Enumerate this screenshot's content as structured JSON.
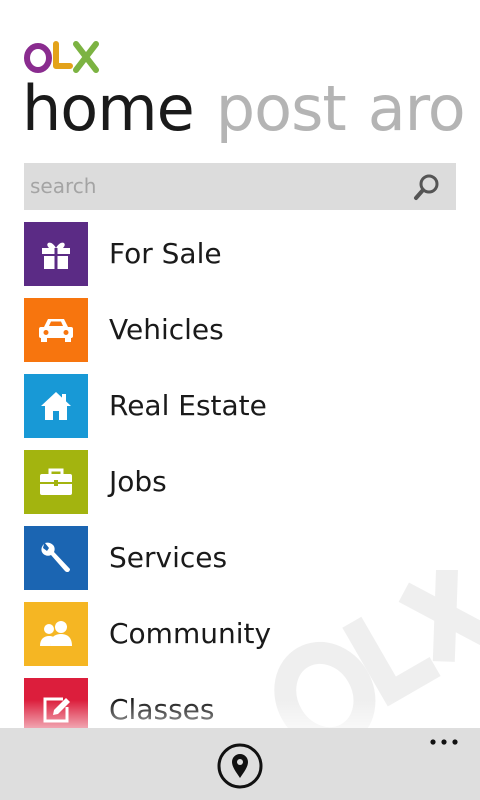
{
  "app": {
    "logo_text": "OLX",
    "logo_colors": [
      "#8a2c8f",
      "#e3a21a",
      "#7cb342"
    ]
  },
  "pivot": {
    "tabs": [
      {
        "label": "home",
        "active": true
      },
      {
        "label": "post",
        "active": false
      },
      {
        "label": "aro",
        "active": false
      }
    ]
  },
  "search": {
    "value": "",
    "placeholder": "search",
    "icon": "search-icon"
  },
  "categories": [
    {
      "label": "For Sale",
      "icon": "gift-icon",
      "color": "#5b2b85"
    },
    {
      "label": "Vehicles",
      "icon": "car-icon",
      "color": "#f7750e"
    },
    {
      "label": "Real Estate",
      "icon": "house-icon",
      "color": "#1899d6"
    },
    {
      "label": "Jobs",
      "icon": "briefcase-icon",
      "color": "#a3b40f"
    },
    {
      "label": "Services",
      "icon": "wrench-icon",
      "color": "#1b65b2"
    },
    {
      "label": "Community",
      "icon": "people-icon",
      "color": "#f5b623"
    },
    {
      "label": "Classes",
      "icon": "edit-icon",
      "color": "#dc1e3c"
    }
  ],
  "appbar": {
    "primary_icon": "location-pin-icon",
    "more_label": "..."
  }
}
